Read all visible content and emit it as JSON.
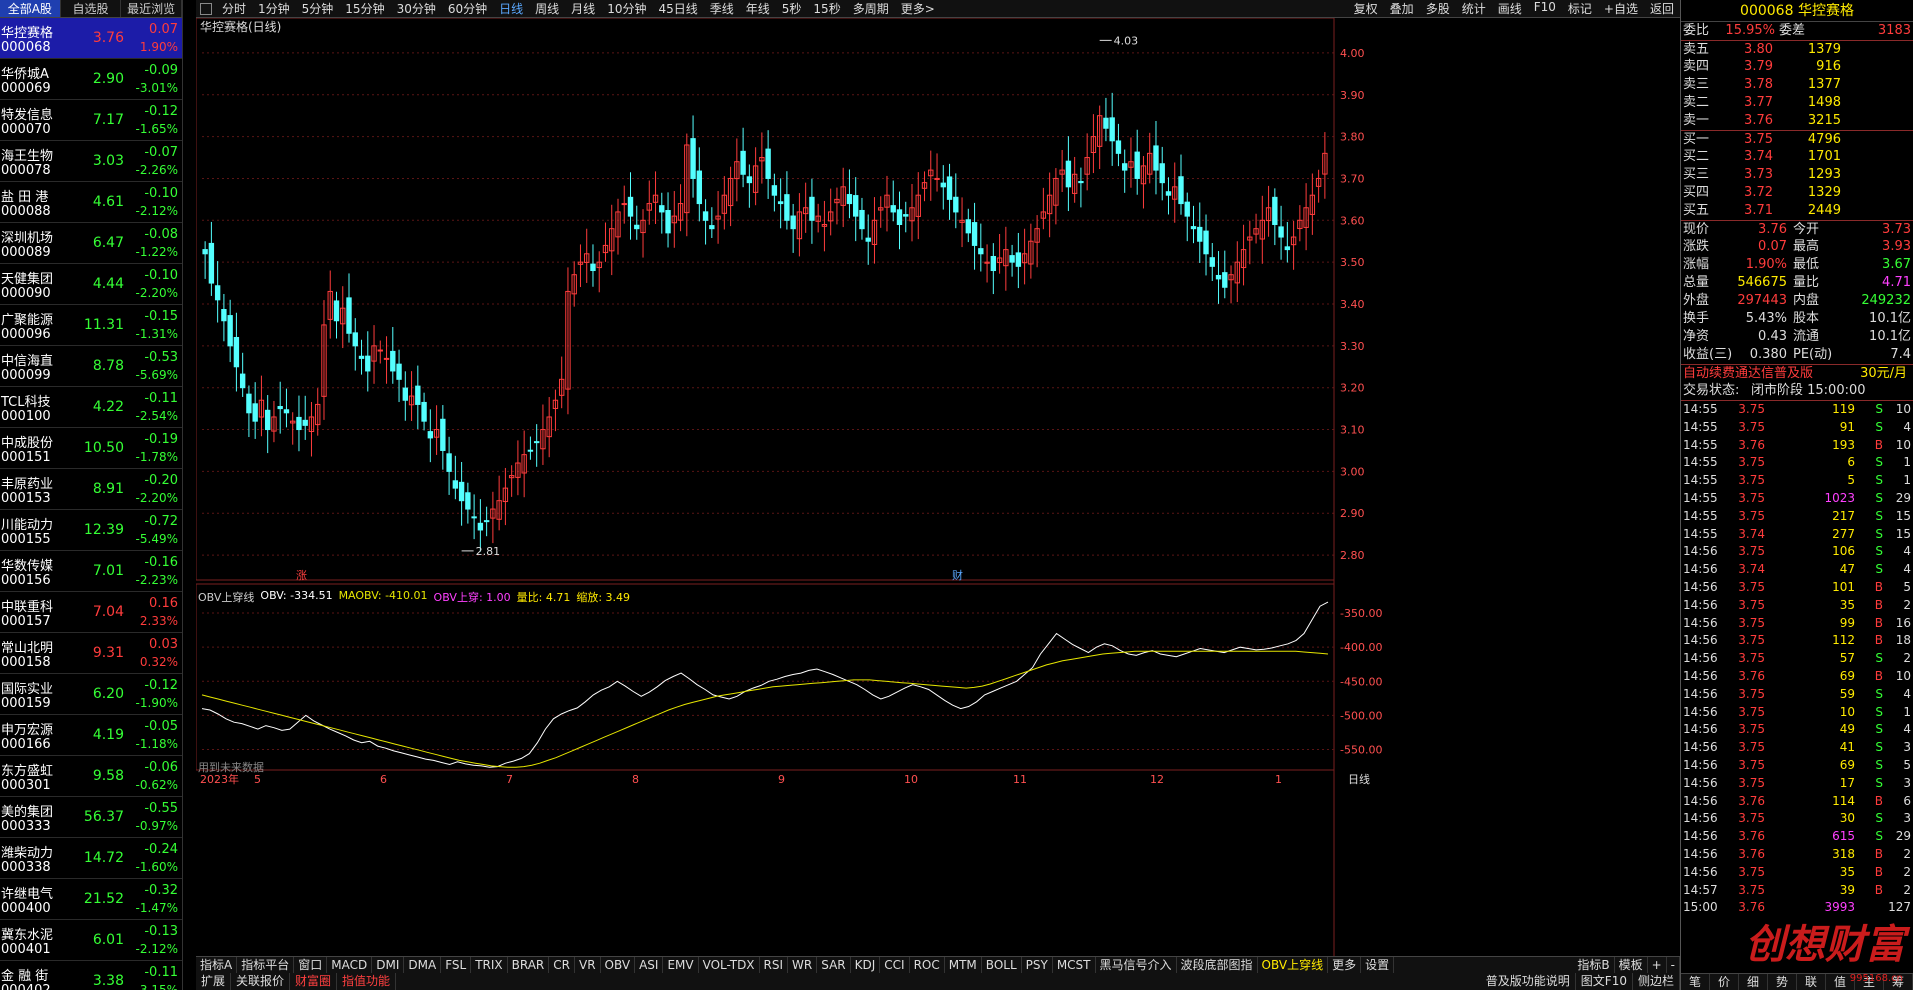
{
  "left_tabs": [
    "全部A股",
    "自选股",
    "最近浏览"
  ],
  "stocks": [
    {
      "name": "华控赛格",
      "code": "000068",
      "price": "3.76",
      "chg": "0.07",
      "pct": "1.90%",
      "dir": "up"
    },
    {
      "name": "华侨城A",
      "code": "000069",
      "price": "2.90",
      "chg": "-0.09",
      "pct": "-3.01%",
      "dir": "dn"
    },
    {
      "name": "特发信息",
      "code": "000070",
      "price": "7.17",
      "chg": "-0.12",
      "pct": "-1.65%",
      "dir": "dn"
    },
    {
      "name": "海王生物",
      "code": "000078",
      "price": "3.03",
      "chg": "-0.07",
      "pct": "-2.26%",
      "dir": "dn"
    },
    {
      "name": "盐 田 港",
      "code": "000088",
      "price": "4.61",
      "chg": "-0.10",
      "pct": "-2.12%",
      "dir": "dn"
    },
    {
      "name": "深圳机场",
      "code": "000089",
      "price": "6.47",
      "chg": "-0.08",
      "pct": "-1.22%",
      "dir": "dn"
    },
    {
      "name": "天健集团",
      "code": "000090",
      "price": "4.44",
      "chg": "-0.10",
      "pct": "-2.20%",
      "dir": "dn"
    },
    {
      "name": "广聚能源",
      "code": "000096",
      "price": "11.31",
      "chg": "-0.15",
      "pct": "-1.31%",
      "dir": "dn"
    },
    {
      "name": "中信海直",
      "code": "000099",
      "price": "8.78",
      "chg": "-0.53",
      "pct": "-5.69%",
      "dir": "dn"
    },
    {
      "name": "TCL科技",
      "code": "000100",
      "price": "4.22",
      "chg": "-0.11",
      "pct": "-2.54%",
      "dir": "dn"
    },
    {
      "name": "中成股份",
      "code": "000151",
      "price": "10.50",
      "chg": "-0.19",
      "pct": "-1.78%",
      "dir": "dn"
    },
    {
      "name": "丰原药业",
      "code": "000153",
      "price": "8.91",
      "chg": "-0.20",
      "pct": "-2.20%",
      "dir": "dn"
    },
    {
      "name": "川能动力",
      "code": "000155",
      "price": "12.39",
      "chg": "-0.72",
      "pct": "-5.49%",
      "dir": "dn"
    },
    {
      "name": "华数传媒",
      "code": "000156",
      "price": "7.01",
      "chg": "-0.16",
      "pct": "-2.23%",
      "dir": "dn"
    },
    {
      "name": "中联重科",
      "code": "000157",
      "price": "7.04",
      "chg": "0.16",
      "pct": "2.33%",
      "dir": "up"
    },
    {
      "name": "常山北明",
      "code": "000158",
      "price": "9.31",
      "chg": "0.03",
      "pct": "0.32%",
      "dir": "up"
    },
    {
      "name": "国际实业",
      "code": "000159",
      "price": "6.20",
      "chg": "-0.12",
      "pct": "-1.90%",
      "dir": "dn"
    },
    {
      "name": "申万宏源",
      "code": "000166",
      "price": "4.19",
      "chg": "-0.05",
      "pct": "-1.18%",
      "dir": "dn"
    },
    {
      "name": "东方盛虹",
      "code": "000301",
      "price": "9.58",
      "chg": "-0.06",
      "pct": "-0.62%",
      "dir": "dn"
    },
    {
      "name": "美的集团",
      "code": "000333",
      "price": "56.37",
      "chg": "-0.55",
      "pct": "-0.97%",
      "dir": "dn"
    },
    {
      "name": "潍柴动力",
      "code": "000338",
      "price": "14.72",
      "chg": "-0.24",
      "pct": "-1.60%",
      "dir": "dn"
    },
    {
      "name": "许继电气",
      "code": "000400",
      "price": "21.52",
      "chg": "-0.32",
      "pct": "-1.47%",
      "dir": "dn"
    },
    {
      "name": "冀东水泥",
      "code": "000401",
      "price": "6.01",
      "chg": "-0.13",
      "pct": "-2.12%",
      "dir": "dn"
    },
    {
      "name": "金 融 街",
      "code": "000402",
      "price": "3.38",
      "chg": "-0.11",
      "pct": "-3.15%",
      "dir": "dn"
    }
  ],
  "toolbar": {
    "periods": [
      "分时",
      "1分钟",
      "5分钟",
      "15分钟",
      "30分钟",
      "60分钟",
      "日线",
      "周线",
      "月线",
      "10分钟",
      "45日线",
      "季线",
      "年线",
      "5秒",
      "15秒",
      "多周期",
      "更多>"
    ],
    "active": "日线",
    "actions": [
      "复权",
      "叠加",
      "多股",
      "统计",
      "画线",
      "F10",
      "标记",
      "+自选",
      "返回"
    ]
  },
  "chart": {
    "title": "华控赛格(日线)",
    "high_label": "4.03",
    "low_label": "2.81",
    "marker_zhang": "涨",
    "marker_cai": "财",
    "future_note": "用到未来数据",
    "period_label": "日线",
    "x_labels": [
      "2023年",
      "5",
      "6",
      "7",
      "8",
      "9",
      "10",
      "11",
      "12",
      "1"
    ]
  },
  "indicator": {
    "name": "OBV上穿线",
    "obv": "OBV: -334.51",
    "maobv": "MAOBV: -410.01",
    "cross": "OBV上穿: 1.00",
    "ratio": "量比: 4.71",
    "shrink": "缩放: 3.49"
  },
  "chart_data": [
    {
      "type": "candlestick",
      "title": "华控赛格(日线)",
      "ylim": [
        2.75,
        4.05
      ],
      "yticks": [
        2.8,
        2.9,
        3.0,
        3.1,
        3.2,
        3.3,
        3.4,
        3.5,
        3.6,
        3.7,
        3.8,
        3.9,
        4.0
      ],
      "annotations": [
        {
          "text": "4.03",
          "value": 4.03
        },
        {
          "text": "2.81",
          "value": 2.81
        }
      ],
      "closes": [
        3.52,
        3.45,
        3.41,
        3.36,
        3.3,
        3.25,
        3.2,
        3.14,
        3.12,
        3.17,
        3.1,
        3.13,
        3.15,
        3.14,
        3.12,
        3.1,
        3.11,
        3.13,
        3.16,
        3.35,
        3.43,
        3.36,
        3.39,
        3.33,
        3.3,
        3.27,
        3.24,
        3.3,
        3.29,
        3.27,
        3.24,
        3.22,
        3.17,
        3.18,
        3.16,
        3.12,
        3.08,
        3.1,
        3.05,
        3.0,
        2.96,
        2.93,
        2.91,
        2.89,
        2.86,
        2.88,
        2.91,
        2.93,
        2.96,
        2.99,
        3.02,
        3.04,
        3.05,
        3.07,
        3.1,
        3.13,
        3.17,
        3.22,
        3.43,
        3.47,
        3.5,
        3.52,
        3.48,
        3.5,
        3.54,
        3.58,
        3.62,
        3.64,
        3.61,
        3.58,
        3.6,
        3.64,
        3.66,
        3.62,
        3.57,
        3.61,
        3.64,
        3.78,
        3.7,
        3.64,
        3.6,
        3.58,
        3.61,
        3.66,
        3.7,
        3.74,
        3.71,
        3.69,
        3.73,
        3.75,
        3.7,
        3.66,
        3.64,
        3.6,
        3.58,
        3.62,
        3.63,
        3.6,
        3.61,
        3.59,
        3.62,
        3.65,
        3.68,
        3.64,
        3.61,
        3.58,
        3.55,
        3.6,
        3.63,
        3.66,
        3.62,
        3.59,
        3.61,
        3.63,
        3.66,
        3.69,
        3.72,
        3.7,
        3.68,
        3.65,
        3.62,
        3.6,
        3.57,
        3.54,
        3.52,
        3.5,
        3.48,
        3.51,
        3.53,
        3.5,
        3.49,
        3.52,
        3.55,
        3.58,
        3.62,
        3.66,
        3.7,
        3.72,
        3.68,
        3.71,
        3.69,
        3.75,
        3.8,
        3.85,
        3.82,
        3.79,
        3.76,
        3.72,
        3.74,
        3.7,
        3.73,
        3.76,
        3.72,
        3.69,
        3.66,
        3.68,
        3.64,
        3.61,
        3.58,
        3.55,
        3.52,
        3.49,
        3.46,
        3.44,
        3.47,
        3.5,
        3.53,
        3.56,
        3.58,
        3.6,
        3.63,
        3.59,
        3.56,
        3.53,
        3.56,
        3.6,
        3.63,
        3.66,
        3.7,
        3.76
      ]
    },
    {
      "type": "line",
      "title": "OBV上穿线",
      "ylim": [
        -580,
        -325
      ],
      "yticks": [
        -350,
        -400,
        -450,
        -500,
        -550
      ],
      "series": [
        {
          "name": "OBV",
          "values": [
            -490,
            -492,
            -498,
            -505,
            -510,
            -512,
            -516,
            -520,
            -515,
            -518,
            -522,
            -520,
            -510,
            -500,
            -508,
            -514,
            -520,
            -525,
            -530,
            -536,
            -540,
            -538,
            -545,
            -548,
            -552,
            -555,
            -558,
            -561,
            -564,
            -566,
            -569,
            -572,
            -568,
            -571,
            -573,
            -574,
            -576,
            -575,
            -570,
            -567,
            -563,
            -556,
            -540,
            -520,
            -505,
            -498,
            -493,
            -489,
            -480,
            -470,
            -463,
            -458,
            -450,
            -457,
            -465,
            -472,
            -466,
            -458,
            -449,
            -443,
            -438,
            -446,
            -455,
            -462,
            -470,
            -473,
            -476,
            -472,
            -465,
            -460,
            -456,
            -450,
            -447,
            -443,
            -440,
            -438,
            -434,
            -432,
            -436,
            -440,
            -445,
            -450,
            -455,
            -462,
            -470,
            -476,
            -472,
            -466,
            -460,
            -455,
            -458,
            -462,
            -470,
            -478,
            -485,
            -490,
            -487,
            -480,
            -470,
            -465,
            -460,
            -455,
            -450,
            -440,
            -430,
            -410,
            -395,
            -380,
            -388,
            -396,
            -402,
            -408,
            -400,
            -395,
            -398,
            -405,
            -410,
            -412,
            -408,
            -405,
            -410,
            -412,
            -414,
            -410,
            -406,
            -402,
            -404,
            -406,
            -408,
            -404,
            -400,
            -402,
            -404,
            -403,
            -401,
            -398,
            -395,
            -390,
            -380,
            -360,
            -340,
            -334
          ]
        },
        {
          "name": "MAOBV",
          "values": [
            -470,
            -473,
            -476,
            -479,
            -482,
            -485,
            -488,
            -491,
            -494,
            -497,
            -500,
            -503,
            -506,
            -509,
            -512,
            -515,
            -518,
            -521,
            -524,
            -527,
            -530,
            -533,
            -536,
            -539,
            -542,
            -545,
            -548,
            -551,
            -554,
            -557,
            -560,
            -563,
            -566,
            -568,
            -570,
            -572,
            -574,
            -575,
            -576,
            -576,
            -575,
            -573,
            -570,
            -566,
            -562,
            -557,
            -552,
            -547,
            -542,
            -537,
            -532,
            -527,
            -522,
            -517,
            -512,
            -507,
            -502,
            -497,
            -492,
            -488,
            -484,
            -481,
            -478,
            -475,
            -472,
            -470,
            -468,
            -466,
            -464,
            -462,
            -460,
            -458,
            -457,
            -456,
            -455,
            -454,
            -453,
            -452,
            -451,
            -450,
            -449,
            -448,
            -448,
            -448,
            -449,
            -450,
            -451,
            -452,
            -453,
            -454,
            -455,
            -456,
            -457,
            -458,
            -459,
            -460,
            -459,
            -457,
            -454,
            -450,
            -446,
            -442,
            -438,
            -434,
            -430,
            -426,
            -423,
            -420,
            -418,
            -416,
            -414,
            -412,
            -410,
            -409,
            -408,
            -407,
            -406,
            -406,
            -406,
            -406,
            -406,
            -406,
            -406,
            -406,
            -406,
            -406,
            -406,
            -406,
            -406,
            -406,
            -406,
            -406,
            -406,
            -406,
            -406,
            -406,
            -406,
            -407,
            -408,
            -409,
            -410
          ]
        }
      ]
    }
  ],
  "btabs1": [
    "指标A",
    "指标平台",
    "窗口",
    "MACD",
    "DMI",
    "DMA",
    "FSL",
    "TRIX",
    "BRAR",
    "CR",
    "VR",
    "OBV",
    "ASI",
    "EMV",
    "VOL-TDX",
    "RSI",
    "WR",
    "SAR",
    "KDJ",
    "CCI",
    "ROC",
    "MTM",
    "BOLL",
    "PSY",
    "MCST",
    "黑马信号介入",
    "波段底部图指",
    "OBV上穿线",
    "更多",
    "设置"
  ],
  "btabs1_active": "OBV上穿线",
  "btabs1_right": [
    "指标B",
    "模板",
    "+",
    "-"
  ],
  "btabs2": [
    "扩展",
    "关联报价",
    "财富圈",
    "指值功能"
  ],
  "btabs2_right": [
    "普及版功能说明",
    "图文F10",
    "侧边栏"
  ],
  "right": {
    "header": "000068 华控赛格",
    "ratio": {
      "wb_label": "委比",
      "wb": "15.95%",
      "wc_label": "委差",
      "wc": "3183"
    },
    "asks": [
      {
        "l": "卖五",
        "p": "3.80",
        "v": "1379"
      },
      {
        "l": "卖四",
        "p": "3.79",
        "v": "916"
      },
      {
        "l": "卖三",
        "p": "3.78",
        "v": "1377"
      },
      {
        "l": "卖二",
        "p": "3.77",
        "v": "1498"
      },
      {
        "l": "卖一",
        "p": "3.76",
        "v": "3215"
      }
    ],
    "bids": [
      {
        "l": "买一",
        "p": "3.75",
        "v": "4796"
      },
      {
        "l": "买二",
        "p": "3.74",
        "v": "1701"
      },
      {
        "l": "买三",
        "p": "3.73",
        "v": "1293"
      },
      {
        "l": "买四",
        "p": "3.72",
        "v": "1329"
      },
      {
        "l": "买五",
        "p": "3.71",
        "v": "2449"
      }
    ],
    "stats": [
      {
        "a": "现价",
        "av": "3.76",
        "b": "今开",
        "bv": "3.73",
        "ac": "up",
        "bc": "up"
      },
      {
        "a": "涨跌",
        "av": "0.07",
        "b": "最高",
        "bv": "3.93",
        "ac": "up",
        "bc": "up"
      },
      {
        "a": "涨幅",
        "av": "1.90%",
        "b": "最低",
        "bv": "3.67",
        "ac": "up",
        "bc": "dn"
      },
      {
        "a": "总量",
        "av": "546675",
        "b": "量比",
        "bv": "4.71",
        "ac": "yel",
        "bc": "mag"
      },
      {
        "a": "外盘",
        "av": "297443",
        "b": "内盘",
        "bv": "249232",
        "ac": "up",
        "bc": "dn"
      },
      {
        "a": "换手",
        "av": "5.43%",
        "b": "股本",
        "bv": "10.1亿",
        "ac": "eq",
        "bc": "eq"
      },
      {
        "a": "净资",
        "av": "0.43",
        "b": "流通",
        "bv": "10.1亿",
        "ac": "eq",
        "bc": "eq"
      },
      {
        "a": "收益(三)",
        "av": "0.380",
        "b": "PE(动)",
        "bv": "7.4",
        "ac": "eq",
        "bc": "eq"
      }
    ],
    "promo": "自动续费通达信普及版",
    "promo_price": "30元/月",
    "state_label": "交易状态:",
    "state": "闭市阶段 15:00:00",
    "ticks": [
      {
        "t": "14:55",
        "p": "3.75",
        "v": "119",
        "s": "S",
        "n": "10"
      },
      {
        "t": "14:55",
        "p": "3.75",
        "v": "91",
        "s": "S",
        "n": "4"
      },
      {
        "t": "14:55",
        "p": "3.76",
        "v": "193",
        "s": "B",
        "n": "10"
      },
      {
        "t": "14:55",
        "p": "3.75",
        "v": "6",
        "s": "S",
        "n": "1"
      },
      {
        "t": "14:55",
        "p": "3.75",
        "v": "5",
        "s": "S",
        "n": "1"
      },
      {
        "t": "14:55",
        "p": "3.75",
        "v": "1023",
        "s": "S",
        "n": "29"
      },
      {
        "t": "14:55",
        "p": "3.75",
        "v": "217",
        "s": "S",
        "n": "15"
      },
      {
        "t": "14:55",
        "p": "3.74",
        "v": "277",
        "s": "S",
        "n": "15"
      },
      {
        "t": "14:56",
        "p": "3.75",
        "v": "106",
        "s": "S",
        "n": "4"
      },
      {
        "t": "14:56",
        "p": "3.74",
        "v": "47",
        "s": "S",
        "n": "4"
      },
      {
        "t": "14:56",
        "p": "3.75",
        "v": "101",
        "s": "B",
        "n": "5"
      },
      {
        "t": "14:56",
        "p": "3.75",
        "v": "35",
        "s": "B",
        "n": "2"
      },
      {
        "t": "14:56",
        "p": "3.75",
        "v": "99",
        "s": "B",
        "n": "16"
      },
      {
        "t": "14:56",
        "p": "3.75",
        "v": "112",
        "s": "B",
        "n": "18"
      },
      {
        "t": "14:56",
        "p": "3.75",
        "v": "57",
        "s": "S",
        "n": "2"
      },
      {
        "t": "14:56",
        "p": "3.76",
        "v": "69",
        "s": "B",
        "n": "10"
      },
      {
        "t": "14:56",
        "p": "3.75",
        "v": "59",
        "s": "S",
        "n": "4"
      },
      {
        "t": "14:56",
        "p": "3.75",
        "v": "10",
        "s": "S",
        "n": "1"
      },
      {
        "t": "14:56",
        "p": "3.75",
        "v": "49",
        "s": "S",
        "n": "4"
      },
      {
        "t": "14:56",
        "p": "3.75",
        "v": "41",
        "s": "S",
        "n": "3"
      },
      {
        "t": "14:56",
        "p": "3.75",
        "v": "69",
        "s": "S",
        "n": "5"
      },
      {
        "t": "14:56",
        "p": "3.75",
        "v": "17",
        "s": "S",
        "n": "3"
      },
      {
        "t": "14:56",
        "p": "3.76",
        "v": "114",
        "s": "B",
        "n": "6"
      },
      {
        "t": "14:56",
        "p": "3.75",
        "v": "30",
        "s": "S",
        "n": "3"
      },
      {
        "t": "14:56",
        "p": "3.76",
        "v": "615",
        "s": "S",
        "n": "29"
      },
      {
        "t": "14:56",
        "p": "3.76",
        "v": "318",
        "s": "B",
        "n": "2"
      },
      {
        "t": "14:56",
        "p": "3.75",
        "v": "35",
        "s": "B",
        "n": "2"
      },
      {
        "t": "14:57",
        "p": "3.75",
        "v": "39",
        "s": "B",
        "n": "2"
      },
      {
        "t": "15:00",
        "p": "3.76",
        "v": "3993",
        "s": "",
        "n": "127"
      }
    ],
    "bottom_tabs": [
      "笔",
      "价",
      "细",
      "势",
      "联",
      "值",
      "主",
      "筹"
    ],
    "watermark": "创想财富",
    "watermark_url": "995168.cn"
  },
  "colors": {
    "up": "#ff3c3c",
    "down": "#35ff35",
    "grid": "#7a1f1f",
    "ma": "#e6e600",
    "obv": "#ffffff"
  }
}
